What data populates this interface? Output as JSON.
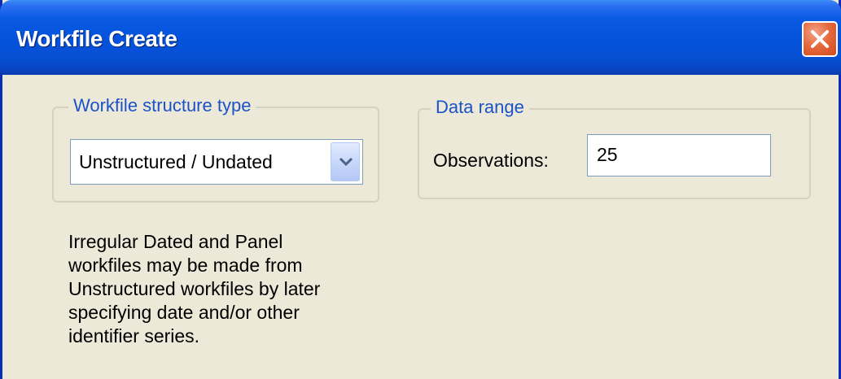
{
  "window": {
    "title": "Workfile Create"
  },
  "structure_group": {
    "legend": "Workfile structure type",
    "combo_value": "Unstructured / Undated"
  },
  "data_range_group": {
    "legend": "Data range",
    "observations_label": "Observations:",
    "observations_value": "25"
  },
  "info": {
    "lines": [
      "Irregular Dated and Panel",
      "workfiles may be made from",
      "Unstructured workfiles by later",
      "specifying date and/or other",
      "identifier series."
    ]
  },
  "colors": {
    "titlebar": "#0553dc",
    "dialog_background": "#ece9d8",
    "group_legend": "#1b52c9",
    "close_button": "#e66a3f"
  },
  "icons": {
    "close": "close-icon",
    "dropdown": "chevron-down-icon"
  }
}
